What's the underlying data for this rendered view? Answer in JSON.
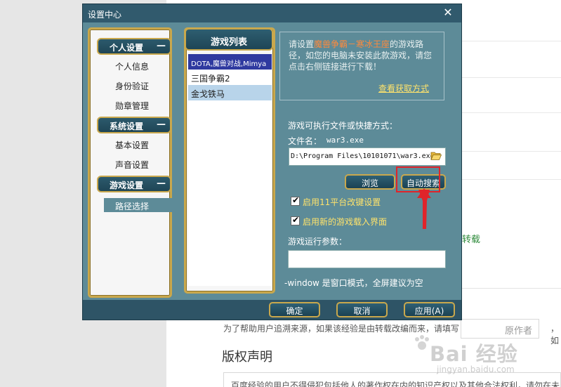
{
  "background_page": {
    "side_link": "转载",
    "source_prompt": "为了帮助用户追溯来源，如果该经验是由转载改编而来，请填写",
    "author_placeholder": "原作者",
    "author_suffix": "，如",
    "copyright_heading": "版权声明",
    "copyright_text": "百度经验的用户不得侵犯包括他人的著作权在内的知识产权以及其他合法权利，请勿在未",
    "watermark": "Bai 经验",
    "watermark_sub": "jingyan.baidu.com"
  },
  "dialog": {
    "title": "设置中心",
    "close_glyph": "✕",
    "categories": [
      {
        "label": "个人设置",
        "toggle": "—",
        "items": [
          "个人信息",
          "身份验证",
          "勋章管理"
        ]
      },
      {
        "label": "系统设置",
        "toggle": "—",
        "items": [
          "基本设置",
          "声音设置"
        ]
      },
      {
        "label": "游戏设置",
        "toggle": "—",
        "items": [
          "路径选择"
        ]
      }
    ],
    "selected_item": "路径选择",
    "game_list": {
      "header": "游戏列表",
      "games": [
        "DOTA,魔兽对战,Mimya",
        "三国争霸2",
        "金戈铁马"
      ],
      "selected_index": 0
    },
    "info": {
      "prefix": "请设置",
      "game_name": "魔兽争霸－寒冰王座",
      "suffix": "的游戏路径，如您的电脑未安装此款游戏，请您点击右侧链接进行下载！",
      "link": "查看获取方式"
    },
    "exe_label": "游戏可执行文件或快捷方式：",
    "filename_label": "文件名：",
    "filename_value": "war3.exe",
    "path_value": "D:\\Program Files\\10101071\\war3.exe",
    "browse_button": "浏览",
    "auto_search_button": "自动搜索",
    "checkboxes": [
      {
        "label": "启用11平台改键设置",
        "checked": true
      },
      {
        "label": "启用新的游戏载入界面",
        "checked": true
      }
    ],
    "params_label": "游戏运行参数：",
    "params_value": "",
    "params_hint": "-window 是窗口模式，全屏建议为空",
    "footer": {
      "ok": "确定",
      "cancel": "取消",
      "apply": "应用(A)"
    }
  },
  "colors": {
    "dialog_frame": "#2e5466",
    "dialog_body": "#5d8b98",
    "gold_border": "#c9a84d",
    "highlight_orange": "#ff8a3c",
    "link_yellow": "#ffe36b",
    "annotation_red": "#e0242a",
    "selected_game_bg": "#2f3aa0"
  },
  "icons": [
    "close-icon",
    "minus-icon",
    "folder-open-icon",
    "checkbox-checked-icon",
    "red-arrow-annotation"
  ]
}
